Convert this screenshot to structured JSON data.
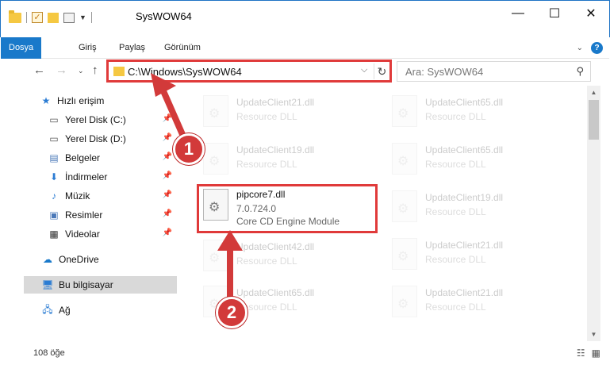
{
  "window": {
    "title": "SysWOW64",
    "controls": {
      "minimize": "—",
      "maximize": "☐",
      "close": "✕"
    }
  },
  "ribbon": {
    "tabs": [
      "Dosya",
      "Giriş",
      "Paylaş",
      "Görünüm"
    ],
    "active_tab": "Dosya",
    "help": "?"
  },
  "address_bar": {
    "path": "C:\\Windows\\SysWOW64",
    "dropdown": "⌵",
    "refresh": "↻"
  },
  "search": {
    "placeholder": "Ara: SysWOW64"
  },
  "nav_pane": {
    "items": [
      {
        "label": "Hızlı erişim",
        "icon": "star-icon",
        "pinned": false
      },
      {
        "label": "Yerel Disk (C:)",
        "icon": "drive-icon",
        "pinned": true
      },
      {
        "label": "Yerel Disk (D:)",
        "icon": "drive-icon",
        "pinned": true
      },
      {
        "label": "Belgeler",
        "icon": "documents-icon",
        "pinned": true
      },
      {
        "label": "İndirmeler",
        "icon": "download-icon",
        "pinned": true
      },
      {
        "label": "Müzik",
        "icon": "music-icon",
        "pinned": true
      },
      {
        "label": "Resimler",
        "icon": "pictures-icon",
        "pinned": true
      },
      {
        "label": "Videolar",
        "icon": "video-icon",
        "pinned": true
      },
      {
        "label": "OneDrive",
        "icon": "cloud-icon",
        "pinned": false
      },
      {
        "label": "Bu bilgisayar",
        "icon": "computer-icon",
        "pinned": false
      },
      {
        "label": "Ağ",
        "icon": "network-icon",
        "pinned": false
      }
    ]
  },
  "files": {
    "left_column": [
      {
        "name": "UpdateClient21.dll",
        "type": "Resource DLL"
      },
      {
        "name": "UpdateClient19.dll",
        "type": "Resource DLL"
      },
      {
        "name": "UpdateClient42.dll",
        "type": "Resource DLL"
      },
      {
        "name": "UpdateClient65.dll",
        "type": "Resource DLL"
      }
    ],
    "right_column": [
      {
        "name": "UpdateClient65.dll",
        "type": "Resource DLL"
      },
      {
        "name": "UpdateClient65.dll",
        "type": "Resource DLL"
      },
      {
        "name": "UpdateClient19.dll",
        "type": "Resource DLL"
      },
      {
        "name": "UpdateClient21.dll",
        "type": "Resource DLL"
      },
      {
        "name": "UpdateClient21.dll",
        "type": "Resource DLL"
      }
    ],
    "highlighted": {
      "name": "pipcore7.dll",
      "version": "7.0.724.0",
      "description": "Core CD Engine Module"
    }
  },
  "status_bar": {
    "item_count": "108 öğe"
  },
  "annotations": {
    "step1": "1",
    "step2": "2"
  },
  "colors": {
    "accent": "#1979ca",
    "highlight": "#e03a3a",
    "badge": "#d23a3a"
  }
}
